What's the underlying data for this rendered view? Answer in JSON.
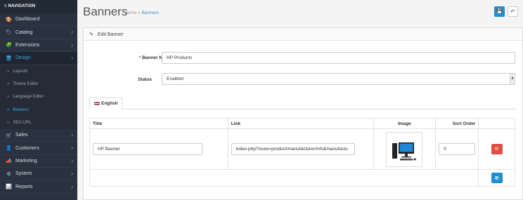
{
  "nav": {
    "header": "≡ NAVIGATION",
    "items": [
      {
        "label": "Dashboard",
        "icon": "🎨",
        "chevron": false
      },
      {
        "label": "Catalog",
        "icon": "🏷",
        "chevron": true
      },
      {
        "label": "Extensions",
        "icon": "🧩",
        "chevron": true
      },
      {
        "label": "Design",
        "icon": "🖥",
        "chevron": true,
        "active": true
      }
    ],
    "subitems": [
      {
        "label": "Layouts"
      },
      {
        "label": "Theme Editor"
      },
      {
        "label": "Language Editor"
      },
      {
        "label": "Banners",
        "active": true
      },
      {
        "label": "SEO URL"
      }
    ],
    "items_bottom": [
      {
        "label": "Sales",
        "icon": "🛒"
      },
      {
        "label": "Customers",
        "icon": "👤"
      },
      {
        "label": "Marketing",
        "icon": "📣"
      },
      {
        "label": "System",
        "icon": "⚙"
      },
      {
        "label": "Reports",
        "icon": "📊"
      }
    ]
  },
  "header": {
    "title": "Banners",
    "breadcrumb_home": "Home",
    "breadcrumb_sep": "»",
    "breadcrumb_current": "Banners",
    "save_icon": "💾",
    "back_icon": "↶"
  },
  "panel": {
    "heading": "Edit Banner",
    "banner_name_label": "Banner Name",
    "banner_name_required": "*",
    "banner_name_value": "HP Products",
    "status_label": "Status",
    "status_value": "Enabled",
    "language_tab": "English"
  },
  "table": {
    "headers": {
      "title": "Title",
      "link": "Link",
      "image": "Image",
      "sort_order": "Sort Order"
    },
    "rows": [
      {
        "title": "HP Banner",
        "link": "index.php?route=product/manufacturer/info&manufactu",
        "sort_order": "0"
      }
    ]
  },
  "colors": {
    "accent": "#1e8fd4",
    "danger": "#e04f43",
    "sidebar_bg": "#2a3240"
  }
}
